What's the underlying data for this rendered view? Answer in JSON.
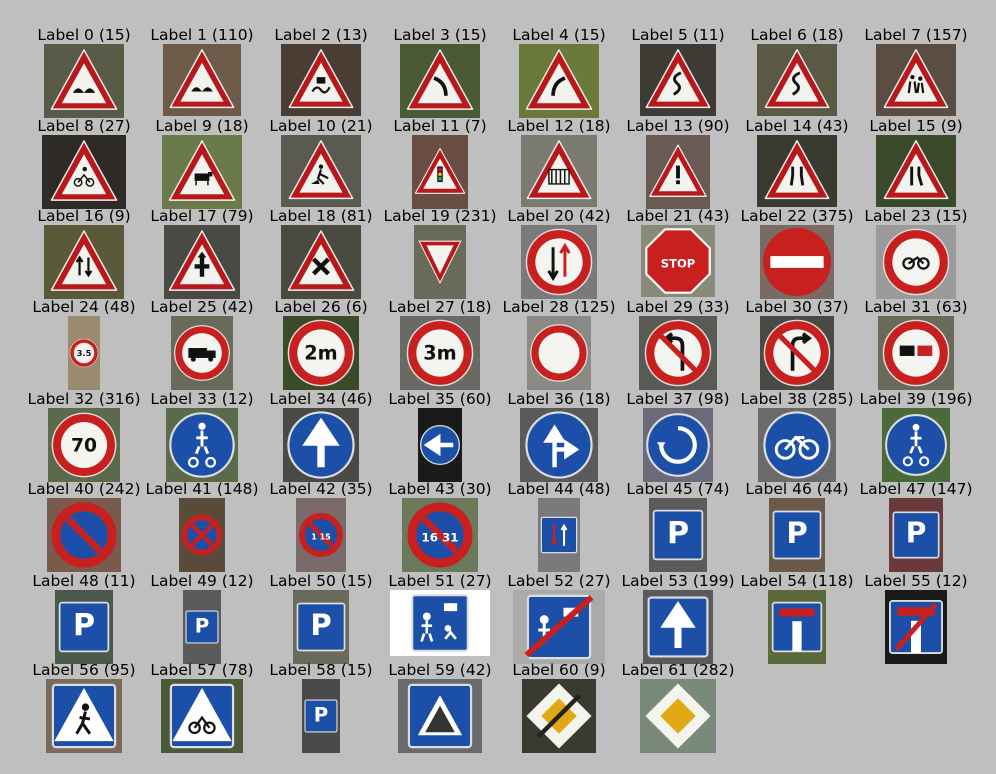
{
  "signs": [
    {
      "label": "Label 0 (15)",
      "shape": "tri",
      "icon": "hump",
      "bg": "#5a5a48"
    },
    {
      "label": "Label 1 (110)",
      "shape": "tri",
      "icon": "hump",
      "bg": "#6e5a48"
    },
    {
      "label": "Label 2 (13)",
      "shape": "tri",
      "icon": "skid",
      "bg": "#4a3e34"
    },
    {
      "label": "Label 3 (15)",
      "shape": "tri",
      "icon": "curve-left",
      "bg": "#4a5a34"
    },
    {
      "label": "Label 4 (15)",
      "shape": "tri",
      "icon": "curve-right",
      "bg": "#6a7a3a"
    },
    {
      "label": "Label 5 (11)",
      "shape": "tri",
      "icon": "s-curve",
      "bg": "#3e3a34"
    },
    {
      "label": "Label 6 (18)",
      "shape": "tri",
      "icon": "s-curve",
      "bg": "#5a5a44"
    },
    {
      "label": "Label 7 (157)",
      "shape": "tri",
      "icon": "children",
      "bg": "#5a4e44"
    },
    {
      "label": "Label 8 (27)",
      "shape": "tri",
      "icon": "cyclist",
      "bg": "#2e2a26"
    },
    {
      "label": "Label 9 (18)",
      "shape": "tri",
      "icon": "cow",
      "bg": "#6a7a4a"
    },
    {
      "label": "Label 10 (21)",
      "shape": "tri",
      "icon": "roadwork",
      "bg": "#5a5a50"
    },
    {
      "label": "Label 11 (7)",
      "shape": "tri",
      "icon": "lights",
      "bg": "#6a4e44"
    },
    {
      "label": "Label 12 (18)",
      "shape": "tri",
      "icon": "rail",
      "bg": "#7a7a70"
    },
    {
      "label": "Label 13 (90)",
      "shape": "tri",
      "icon": "exclam",
      "bg": "#6a5a54"
    },
    {
      "label": "Label 14 (43)",
      "shape": "tri",
      "icon": "narrow",
      "bg": "#3a3a30"
    },
    {
      "label": "Label 15 (9)",
      "shape": "tri",
      "icon": "narrow-right",
      "bg": "#3a4a2a"
    },
    {
      "label": "Label 16 (9)",
      "shape": "tri",
      "icon": "two-way",
      "bg": "#5a5a3a"
    },
    {
      "label": "Label 17 (79)",
      "shape": "tri",
      "icon": "priority-cross",
      "bg": "#4a4a44"
    },
    {
      "label": "Label 18 (81)",
      "shape": "tri",
      "icon": "cross",
      "bg": "#4a4a40"
    },
    {
      "label": "Label 19 (231)",
      "shape": "yield",
      "icon": "",
      "bg": "#6a6a5a"
    },
    {
      "label": "Label 20 (42)",
      "shape": "circle-red",
      "icon": "oncoming",
      "bg": "#7a7a7a"
    },
    {
      "label": "Label 21 (43)",
      "shape": "stop",
      "icon": "",
      "bg": "#8a8a7a",
      "text": "STOP"
    },
    {
      "label": "Label 22 (375)",
      "shape": "noentry",
      "icon": "",
      "bg": "#7a6a64"
    },
    {
      "label": "Label 23 (15)",
      "shape": "circle-red",
      "icon": "moto",
      "bg": "#9a9a9a"
    },
    {
      "label": "Label 24 (48)",
      "shape": "circle-red",
      "icon": "",
      "bg": "#9a8a70",
      "text": "3.5"
    },
    {
      "label": "Label 25 (42)",
      "shape": "circle-red",
      "icon": "truck",
      "bg": "#6a6a5a"
    },
    {
      "label": "Label 26 (6)",
      "shape": "circle-red",
      "icon": "",
      "bg": "#3a4a2a",
      "text": "2m"
    },
    {
      "label": "Label 27 (18)",
      "shape": "circle-red",
      "icon": "",
      "bg": "#6a6a64",
      "text": "3m"
    },
    {
      "label": "Label 28 (125)",
      "shape": "circle-red",
      "icon": "",
      "bg": "#8a8a84"
    },
    {
      "label": "Label 29 (33)",
      "shape": "circle-red",
      "icon": "no-left",
      "bg": "#5a5a54"
    },
    {
      "label": "Label 30 (37)",
      "shape": "circle-red",
      "icon": "no-right",
      "bg": "#4a4a44"
    },
    {
      "label": "Label 31 (63)",
      "shape": "circle-red",
      "icon": "no-overtake",
      "bg": "#6a6a5a"
    },
    {
      "label": "Label 32 (316)",
      "shape": "circle-red",
      "icon": "",
      "bg": "#5a6a4a",
      "text": "70"
    },
    {
      "label": "Label 33 (12)",
      "shape": "circle-blue",
      "icon": "ped-bike",
      "bg": "#5a6a4a"
    },
    {
      "label": "Label 34 (46)",
      "shape": "circle-blue",
      "icon": "up",
      "bg": "#4a4a44"
    },
    {
      "label": "Label 35 (60)",
      "shape": "circle-blue",
      "icon": "left",
      "bg": "#1a1a1a"
    },
    {
      "label": "Label 36 (18)",
      "shape": "circle-blue",
      "icon": "up-right",
      "bg": "#5a5a5a"
    },
    {
      "label": "Label 37 (98)",
      "shape": "circle-blue",
      "icon": "round",
      "bg": "#6a6a7a"
    },
    {
      "label": "Label 38 (285)",
      "shape": "circle-blue",
      "icon": "bike",
      "bg": "#6a6a6a"
    },
    {
      "label": "Label 39 (196)",
      "shape": "circle-blue",
      "icon": "ped-bike",
      "bg": "#4a6a3a"
    },
    {
      "label": "Label 40 (242)",
      "shape": "noparking",
      "icon": "",
      "bg": "#7a5a4a"
    },
    {
      "label": "Label 41 (148)",
      "shape": "nostop",
      "icon": "",
      "bg": "#5a4a3a"
    },
    {
      "label": "Label 42 (35)",
      "shape": "noparking",
      "icon": "",
      "bg": "#7a6a6a",
      "text": "1 15"
    },
    {
      "label": "Label 43 (30)",
      "shape": "noparking",
      "icon": "",
      "bg": "#6a7a5a",
      "text": "16 31"
    },
    {
      "label": "Label 44 (48)",
      "shape": "rect-blue",
      "icon": "updown",
      "bg": "#7a7a7a"
    },
    {
      "label": "Label 45 (74)",
      "shape": "rect-blue",
      "icon": "",
      "bg": "#5a5a5a",
      "text": "P"
    },
    {
      "label": "Label 46 (44)",
      "shape": "rect-blue",
      "icon": "",
      "bg": "#6a5a4a",
      "text": "P"
    },
    {
      "label": "Label 47 (147)",
      "shape": "rect-blue",
      "icon": "",
      "bg": "#6a3a3a",
      "text": "P"
    },
    {
      "label": "Label 48 (11)",
      "shape": "rect-blue",
      "icon": "",
      "bg": "#4a5a4a",
      "text": "P"
    },
    {
      "label": "Label 49 (12)",
      "shape": "rect-blue",
      "icon": "",
      "bg": "#5a5a5a",
      "text": "P"
    },
    {
      "label": "Label 50 (15)",
      "shape": "rect-blue",
      "icon": "",
      "bg": "#6a6a5a",
      "text": "P"
    },
    {
      "label": "Label 51 (27)",
      "shape": "rect-blue",
      "icon": "resi",
      "bg": "#ffffff"
    },
    {
      "label": "Label 52 (27)",
      "shape": "rect-blue",
      "icon": "resi-end",
      "bg": "#aaaaaa"
    },
    {
      "label": "Label 53 (199)",
      "shape": "rect-blue",
      "icon": "up",
      "bg": "#5a5a5a"
    },
    {
      "label": "Label 54 (118)",
      "shape": "rect-blue",
      "icon": "deadend",
      "bg": "#5a6a3a"
    },
    {
      "label": "Label 55 (12)",
      "shape": "rect-blue",
      "icon": "deadend-x",
      "bg": "#1a1a1a"
    },
    {
      "label": "Label 56 (95)",
      "shape": "rect-blue",
      "icon": "crossing",
      "bg": "#7a6a5a"
    },
    {
      "label": "Label 57 (78)",
      "shape": "rect-blue",
      "icon": "bike-cross",
      "bg": "#4a5a3a"
    },
    {
      "label": "Label 58 (15)",
      "shape": "rect-blue",
      "icon": "",
      "bg": "#4a4a4a",
      "text": "P"
    },
    {
      "label": "Label 59 (42)",
      "shape": "rect-blue",
      "icon": "hump-sq",
      "bg": "#6a6a6a"
    },
    {
      "label": "Label 60 (9)",
      "shape": "diamond-end",
      "icon": "",
      "bg": "#3a3a30"
    },
    {
      "label": "Label 61 (282)",
      "shape": "diamond",
      "icon": "",
      "bg": "#7a8a7a"
    }
  ]
}
